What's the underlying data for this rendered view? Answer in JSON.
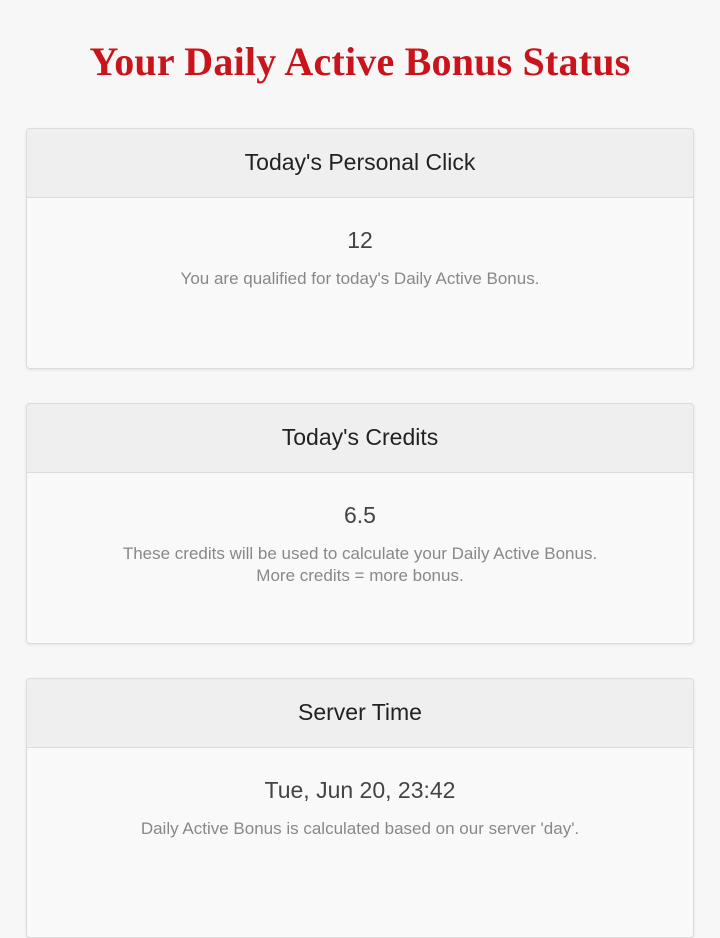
{
  "page": {
    "title": "Your Daily Active Bonus Status"
  },
  "colors": {
    "title": "#c9141b",
    "background": "#f7f7f7",
    "card_header": "#efefef"
  },
  "cards": [
    {
      "header": "Today's Personal Click",
      "value": "12",
      "description_lines": [
        "You are qualified for today's Daily Active Bonus."
      ]
    },
    {
      "header": "Today's Credits",
      "value": "6.5",
      "description_lines": [
        "These credits will be used to calculate your Daily Active Bonus.",
        "More credits = more bonus."
      ]
    },
    {
      "header": "Server Time",
      "value": "Tue, Jun 20, 23:42",
      "description_lines": [
        "Daily Active Bonus is calculated based on our server 'day'."
      ]
    }
  ]
}
